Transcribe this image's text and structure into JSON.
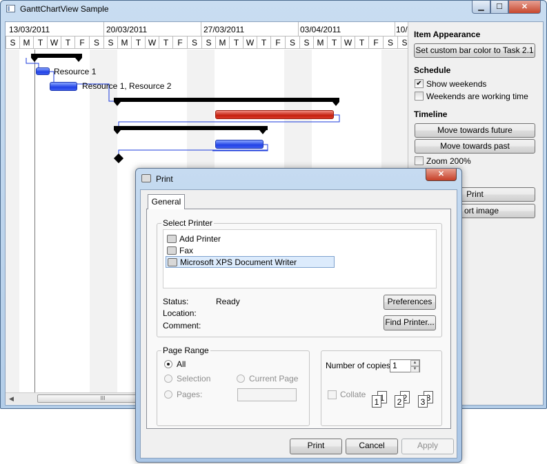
{
  "window": {
    "title": "GanttChartView Sample"
  },
  "gantt": {
    "weeks": [
      "13/03/2011",
      "20/03/2011",
      "27/03/2011",
      "03/04/2011",
      "10/"
    ],
    "days": [
      "S",
      "M",
      "T",
      "W",
      "T",
      "F",
      "S",
      "S",
      "M",
      "T",
      "W",
      "T",
      "F",
      "S",
      "S",
      "M",
      "T",
      "W",
      "T",
      "F",
      "S",
      "S",
      "M",
      "T",
      "W",
      "T",
      "F",
      "S",
      "S"
    ],
    "resource_labels": [
      "Resource 1",
      "Resource 1, Resource 2"
    ],
    "scroll_grip": "III"
  },
  "panel": {
    "item_appearance_title": "Item Appearance",
    "set_color_button": "Set custom bar color to Task 2.1",
    "schedule_title": "Schedule",
    "show_weekends_label": "Show weekends",
    "show_weekends_checked": true,
    "working_weekends_label": "Weekends are working time",
    "working_weekends_checked": false,
    "timeline_title": "Timeline",
    "move_future_button": "Move towards future",
    "move_past_button": "Move towards past",
    "zoom_label": "Zoom 200%",
    "zoom_checked": false,
    "print_button": "Print",
    "export_button": "ort image"
  },
  "dialog": {
    "title": "Print",
    "tab": "General",
    "select_printer_group": "Select Printer",
    "printers": [
      "Add Printer",
      "Fax",
      "Microsoft XPS Document Writer"
    ],
    "selected_printer": "Microsoft XPS Document Writer",
    "status_label": "Status:",
    "status_value": "Ready",
    "location_label": "Location:",
    "comment_label": "Comment:",
    "preferences_button": "Preferences",
    "find_printer_button": "Find Printer...",
    "page_range_group": "Page Range",
    "range_all": "All",
    "range_selection": "Selection",
    "range_current": "Current Page",
    "range_pages": "Pages:",
    "copies_label": "Number of copies:",
    "copies_value": "1",
    "collate_label": "Collate",
    "collate_numbers": [
      "1",
      "1",
      "2",
      "2",
      "3",
      "3"
    ],
    "print_button": "Print",
    "cancel_button": "Cancel",
    "apply_button": "Apply"
  },
  "colors": {
    "accent_blue": "#2243e6",
    "accent_red": "#c4200f",
    "dependency_line": "#1a3adb"
  },
  "icons": [
    "app-icon",
    "minimize-icon",
    "maximize-icon",
    "close-icon",
    "printer-icon",
    "add-printer-icon",
    "fax-icon",
    "xps-printer-icon",
    "scroll-left-icon",
    "scroll-right-icon",
    "spin-up-icon",
    "spin-down-icon",
    "collate-icon"
  ]
}
